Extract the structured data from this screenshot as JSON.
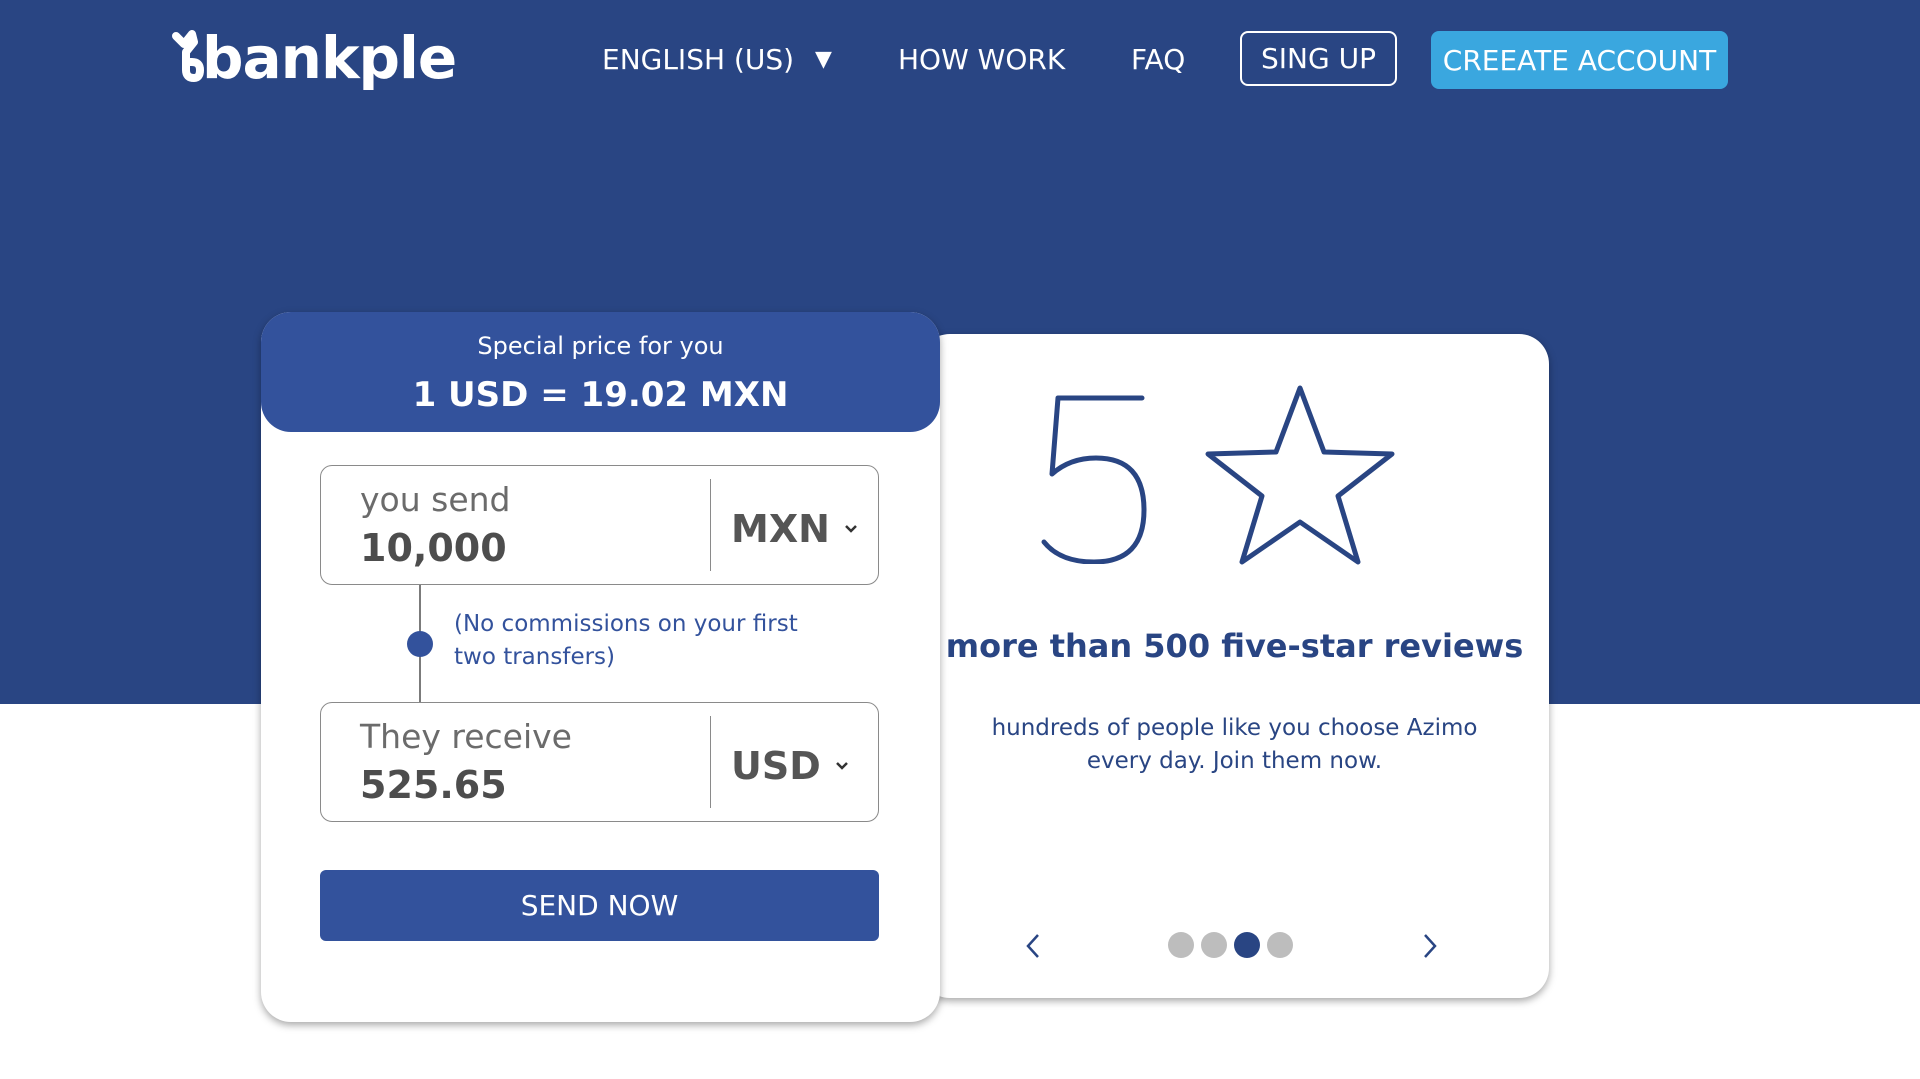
{
  "header": {
    "logo_text": "bankple",
    "language": "ENGLISH (US)",
    "nav": {
      "how_work": "HOW WORK",
      "faq": "FAQ"
    },
    "signup_label": "SING UP",
    "create_account_label": "CREEATE ACCOUNT"
  },
  "converter": {
    "special_label": "Special price for you",
    "rate": "1 USD = 19.02 MXN",
    "send": {
      "label": "you send",
      "value": "10,000",
      "currency": "MXN"
    },
    "commission_note": "(No commissions on your first two transfers)",
    "receive": {
      "label": "They receive",
      "value": "525.65",
      "currency": "USD"
    },
    "send_button": "SEND NOW"
  },
  "reviews": {
    "rating_number": "5",
    "title": "more than 500 five-star reviews",
    "subtitle": "hundreds of people like you choose Azimo every day. Join them now.",
    "carousel": {
      "total_slides": 4,
      "active_slide": 3
    }
  },
  "colors": {
    "hero_bg": "#294583",
    "card_header": "#33529c",
    "create_account_bg": "#3aa7df",
    "dot_inactive": "#bdbdbd",
    "dot_active": "#294583"
  }
}
